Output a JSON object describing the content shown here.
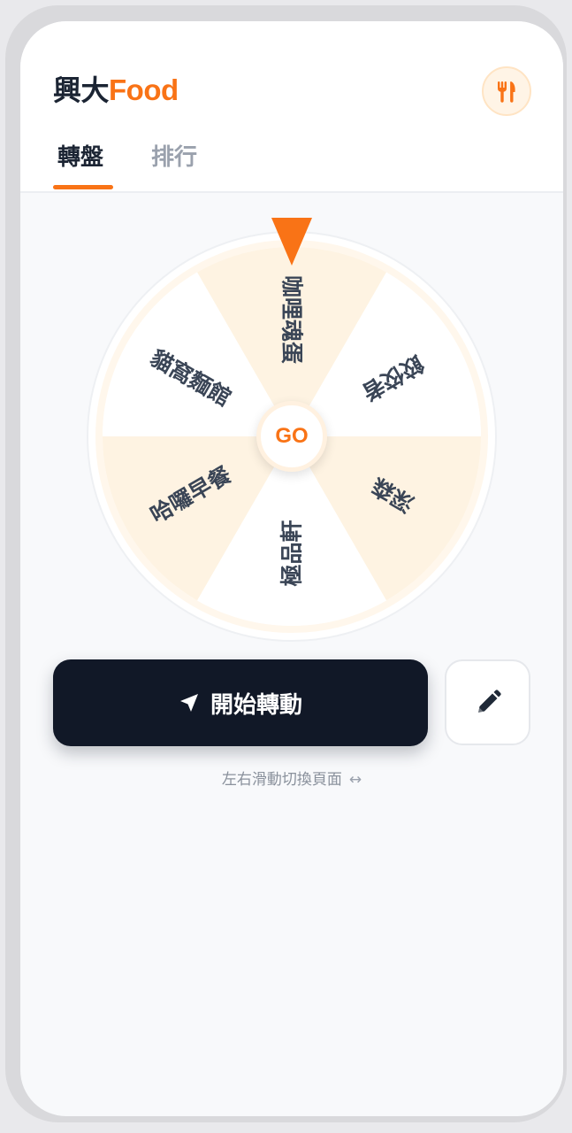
{
  "header": {
    "logo_cn": "興大",
    "logo_en": "Food",
    "icon": "fork-knife-icon"
  },
  "tabs": [
    {
      "label": "轉盤",
      "active": true
    },
    {
      "label": "排行",
      "active": false
    }
  ],
  "wheel": {
    "center_label": "GO",
    "pointer_icon": "pointer-triangle-icon",
    "segments": [
      {
        "label": "咖哩魂蛋",
        "color": "#fef3e2"
      },
      {
        "label": "餃佼者",
        "color": "#ffffff"
      },
      {
        "label": "深森",
        "color": "#fef3e2"
      },
      {
        "label": "極品軒",
        "color": "#ffffff"
      },
      {
        "label": "哈囉早餐",
        "color": "#fef3e2"
      },
      {
        "label": "貓窩麵館",
        "color": "#ffffff"
      }
    ]
  },
  "actions": {
    "spin_label": "開始轉動",
    "spin_icon": "navigation-arrow-icon",
    "edit_icon": "pencil-icon"
  },
  "hint": {
    "text": "左右滑動切換頁面",
    "icon": "left-right-arrow-icon",
    "arrows": "↔"
  },
  "colors": {
    "accent": "#f97316",
    "dark": "#111827",
    "segment_tint": "#fef3e2"
  }
}
